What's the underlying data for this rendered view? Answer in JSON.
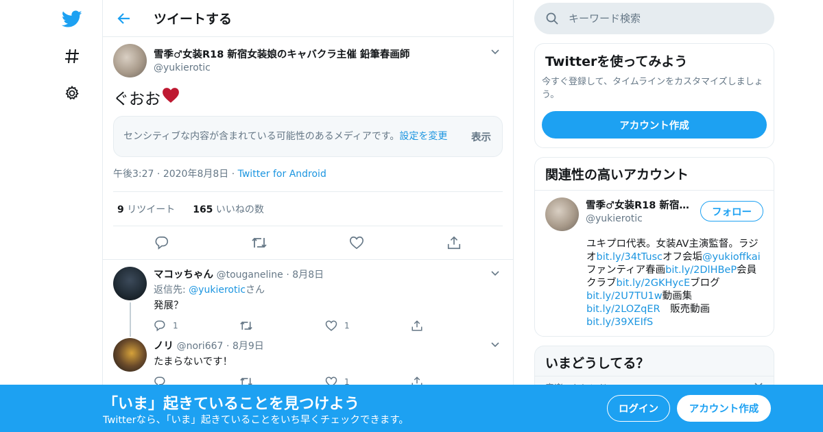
{
  "header": {
    "title": "ツイートする"
  },
  "tweet": {
    "author_name": "雪季♂女装R18 新宿女装娘のキャバクラ主催 鉛筆春画師",
    "handle": "@yukierotic",
    "text": "ぐおお",
    "sensitive_text": "センシティブな内容が含まれている可能性のあるメディアです。",
    "sensitive_link": "設定を変更",
    "show_label": "表示",
    "time": "午後3:27",
    "date": "2020年8月8日",
    "via": "Twitter for Android",
    "retweet_count": "9",
    "retweet_label": "リツイート",
    "like_count": "165",
    "like_label": "いいねの数"
  },
  "replies": [
    {
      "name": "マコッちゃん",
      "handle": "@touganeline",
      "date": "8月8日",
      "reply_to_prefix": "返信先: ",
      "reply_to_handle": "@yukierotic",
      "reply_to_suffix": "さん",
      "text": "発展？",
      "reply_count": "1",
      "like_count": "1"
    },
    {
      "name": "ノリ",
      "handle": "@nori667",
      "date": "8月9日",
      "text": "たまらないです！",
      "reply_count": "",
      "like_count": "1"
    }
  ],
  "sidebar": {
    "search_placeholder": "キーワード検索",
    "signup_card": {
      "title": "Twitterを使ってみよう",
      "subtitle": "今すぐ登録して、タイムラインをカスタマイズしましょう。",
      "button": "アカウント作成"
    },
    "related": {
      "title": "関連性の高いアカウント",
      "name": "雪季♂女装R18 新宿女装娘のキャバクラ主催 鉛筆春画師",
      "handle": "@yukierotic",
      "follow": "フォロー",
      "bio": [
        {
          "t": "ユキプロ代表。女装AV主演監督。ラジオ",
          "link": false
        },
        {
          "t": "bit.ly/34tTusc",
          "link": true
        },
        {
          "t": "オフ会垢",
          "link": false
        },
        {
          "t": "@yukioffkai",
          "link": true
        },
        {
          "t": "ファンティア春画",
          "link": false
        },
        {
          "t": "bit.ly/2DlHBeP",
          "link": true
        },
        {
          "t": "会員クラブ",
          "link": false
        },
        {
          "t": "bit.ly/2GKHycE",
          "link": true
        },
        {
          "t": "ブログ",
          "link": false
        },
        {
          "t": "bit.ly/2U7TU1w",
          "link": true
        },
        {
          "t": "動画集",
          "link": false
        },
        {
          "t": "bit.ly/2LOZqER",
          "link": true
        },
        {
          "t": "　販売動画　",
          "link": false
        },
        {
          "t": "bit.ly/39XEIfS",
          "link": true
        }
      ]
    },
    "trends": {
      "title": "いまどうしてる？",
      "first": "音楽 · トレンド"
    }
  },
  "bottom_bar": {
    "title": "「いま」起きていることを見つけよう",
    "subtitle": "Twitterなら、「いま」起きていることをいち早くチェックできます。",
    "login": "ログイン",
    "signup": "アカウント作成"
  },
  "colors": {
    "accent": "#1da1f2",
    "link": "#1b95e0",
    "muted": "#657786",
    "border": "#e6ecf0",
    "heart": "#e0245e"
  }
}
